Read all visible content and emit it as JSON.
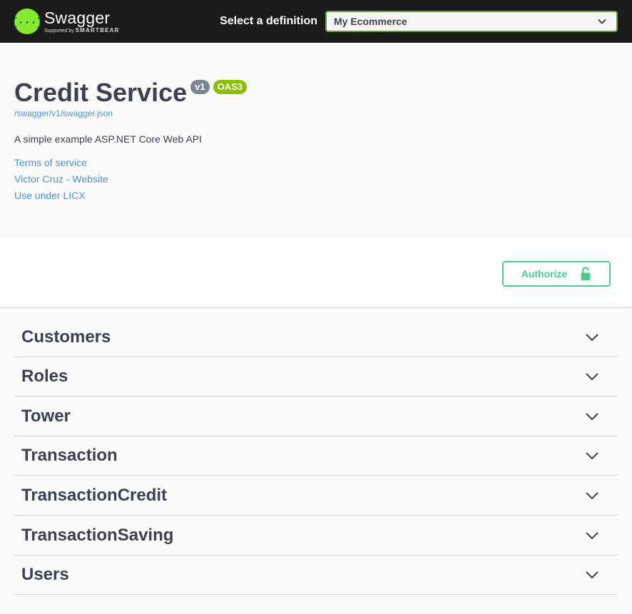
{
  "topbar": {
    "brand_name": "Swagger",
    "brand_sub_prefix": "Supported by",
    "brand_sub_company": "SMARTBEAR",
    "definition_label": "Select a definition",
    "definition_selected": "My Ecommerce",
    "logo_icon": "swagger-braces-icon",
    "accent_color": "#85ea2d"
  },
  "info": {
    "title": "Credit Service",
    "version_badge": "v1",
    "oas_badge": "OAS3",
    "spec_url": "/swagger/v1/swagger.json",
    "description": "A simple example ASP.NET Core Web API",
    "links": {
      "terms": "Terms of service",
      "contact": "Victor Cruz - Website",
      "license": "Use under LICX"
    }
  },
  "auth": {
    "authorize_label": "Authorize",
    "icon": "unlocked-lock-icon",
    "color": "#49cc90"
  },
  "tags": [
    {
      "name": "Customers"
    },
    {
      "name": "Roles"
    },
    {
      "name": "Tower"
    },
    {
      "name": "Transaction"
    },
    {
      "name": "TransactionCredit"
    },
    {
      "name": "TransactionSaving"
    },
    {
      "name": "Users"
    }
  ]
}
